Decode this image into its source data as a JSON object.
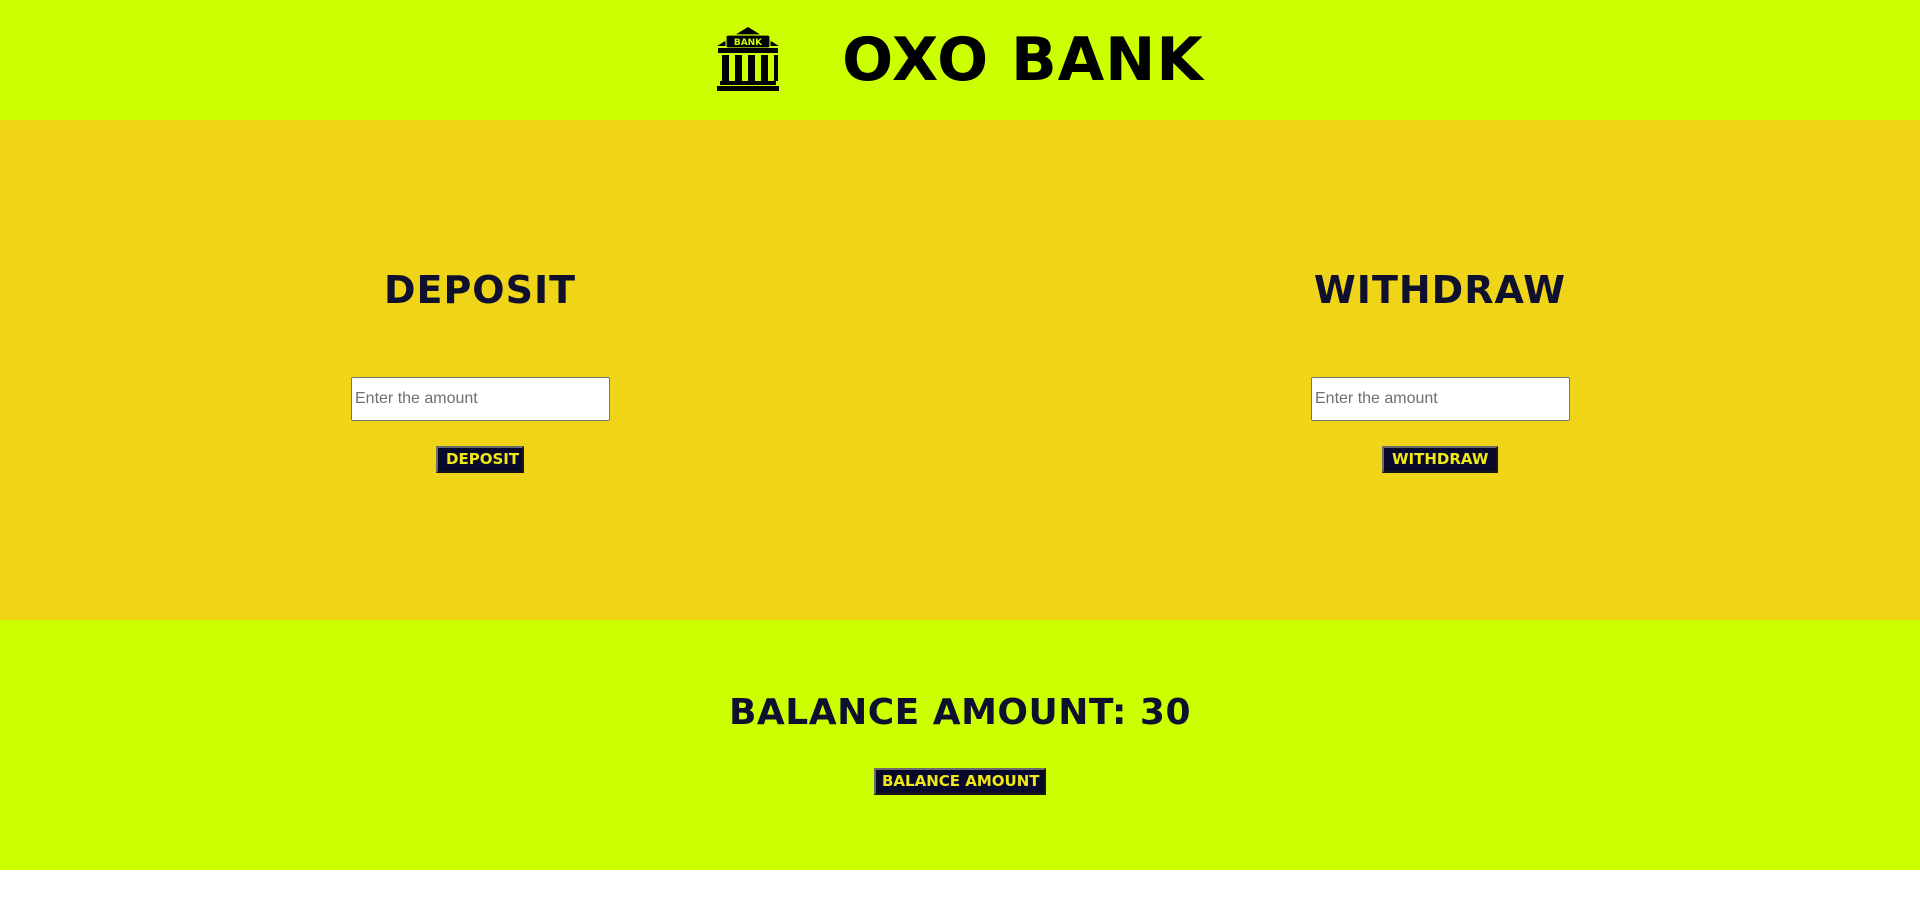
{
  "header": {
    "logo_icon": "bank-building-icon",
    "logo_text": "BANK",
    "title": "OXO BANK"
  },
  "deposit": {
    "title": "DEPOSIT",
    "input_placeholder": "Enter the amount",
    "input_value": "",
    "button_label": "DEPOSIT"
  },
  "withdraw": {
    "title": "WITHDRAW",
    "input_placeholder": "Enter the amount",
    "input_value": "",
    "button_label": "WITHDRAW"
  },
  "balance": {
    "label": "BALANCE AMOUNT: 30",
    "button_label": "BALANCE AMOUNT"
  },
  "colors": {
    "header_bg": "#ccff00",
    "middle_bg": "#f0d418",
    "button_bg": "#07082a",
    "button_text": "#f0e818",
    "heading_text": "#0f0f2e"
  }
}
